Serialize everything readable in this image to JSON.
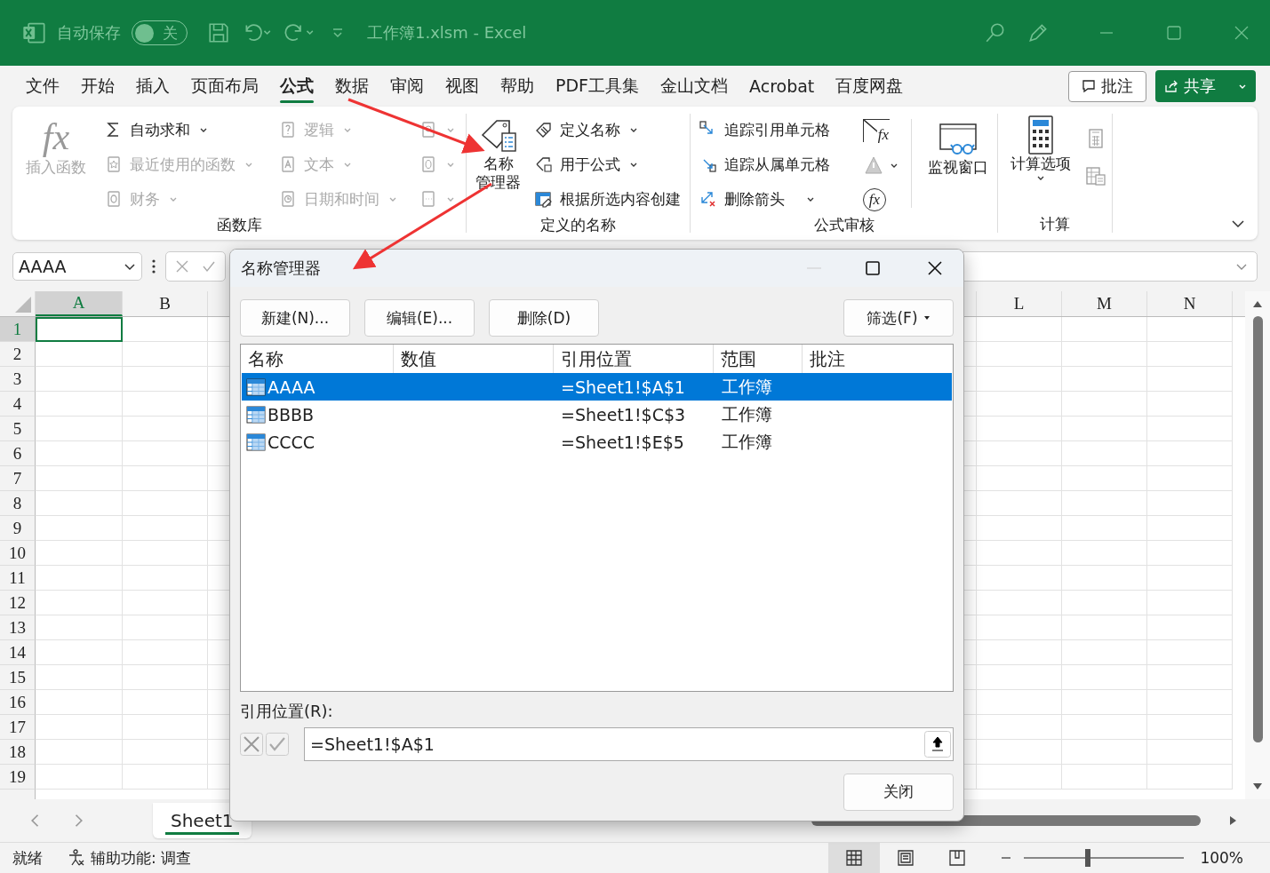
{
  "title_bar": {
    "autosave_label": "自动保存",
    "autosave": {
      "on": false,
      "label": "关"
    },
    "title": "工作簿1.xlsm  -  Excel"
  },
  "menu_tabs": [
    {
      "label": "文件",
      "selected": false
    },
    {
      "label": "开始",
      "selected": false
    },
    {
      "label": "插入",
      "selected": false
    },
    {
      "label": "页面布局",
      "selected": false
    },
    {
      "label": "公式",
      "selected": true
    },
    {
      "label": "数据",
      "selected": false
    },
    {
      "label": "审阅",
      "selected": false
    },
    {
      "label": "视图",
      "selected": false
    },
    {
      "label": "帮助",
      "selected": false
    },
    {
      "label": "PDF工具集",
      "selected": false
    },
    {
      "label": "金山文档",
      "selected": false
    },
    {
      "label": "Acrobat",
      "selected": false
    },
    {
      "label": "百度网盘",
      "selected": false
    }
  ],
  "comment_button": "批注",
  "share_button": "共享",
  "ribbon": {
    "function_library": {
      "label": "函数库",
      "insert_function": {
        "icon_text": "fx",
        "label": "插入函数",
        "disabled": true
      },
      "column_1": [
        {
          "label": "自动求和",
          "disabled": false
        },
        {
          "label": "最近使用的函数",
          "disabled": true
        },
        {
          "label": "财务",
          "disabled": true
        }
      ],
      "column_2": [
        {
          "label": "逻辑",
          "disabled": true
        },
        {
          "label": "文本",
          "disabled": true
        },
        {
          "label": "日期和时间",
          "disabled": true
        }
      ],
      "column_3": [
        {
          "disabled": true
        },
        {
          "disabled": true
        },
        {
          "disabled": true
        }
      ]
    },
    "defined_names": {
      "label": "定义的名称",
      "name_manager": [
        "名称",
        "管理器"
      ],
      "items": [
        {
          "label": "定义名称",
          "dropdown": true
        },
        {
          "label": "用于公式",
          "dropdown": true
        },
        {
          "label": "根据所选内容创建",
          "dropdown": false
        }
      ]
    },
    "formula_auditing": {
      "label": "公式审核",
      "icon_texts": [
        "fx",
        "fx"
      ],
      "items": [
        {
          "label": "追踪引用单元格",
          "dropdown": false
        },
        {
          "label": "追踪从属单元格",
          "dropdown": false
        },
        {
          "label": "删除箭头",
          "dropdown": true
        }
      ],
      "watch_window": "监视窗口"
    },
    "calculation": {
      "label": "计算",
      "options": "计算选项"
    }
  },
  "name_box": "AAAA",
  "columns": [
    {
      "label": "A",
      "selected": true
    },
    {
      "label": "B",
      "selected": false
    },
    {
      "label": "L",
      "selected": false
    },
    {
      "label": "M",
      "selected": false
    },
    {
      "label": "N",
      "selected": false
    }
  ],
  "rows": [
    {
      "label": "1",
      "selected": true
    },
    {
      "label": "2",
      "selected": false
    },
    {
      "label": "3",
      "selected": false
    },
    {
      "label": "4",
      "selected": false
    },
    {
      "label": "5",
      "selected": false
    },
    {
      "label": "6",
      "selected": false
    },
    {
      "label": "7",
      "selected": false
    },
    {
      "label": "8",
      "selected": false
    },
    {
      "label": "9",
      "selected": false
    },
    {
      "label": "10",
      "selected": false
    },
    {
      "label": "11",
      "selected": false
    },
    {
      "label": "12",
      "selected": false
    },
    {
      "label": "13",
      "selected": false
    },
    {
      "label": "14",
      "selected": false
    },
    {
      "label": "15",
      "selected": false
    },
    {
      "label": "16",
      "selected": false
    },
    {
      "label": "17",
      "selected": false
    },
    {
      "label": "18",
      "selected": false
    },
    {
      "label": "19",
      "selected": false
    }
  ],
  "sheet_tabs": [
    {
      "label": "Sheet1",
      "selected": true
    }
  ],
  "status_bar": {
    "status": "就绪",
    "accessibility": "辅助功能: 调查",
    "zoom": {
      "level": 0.4
    },
    "zoom_text": "100%"
  },
  "dialog": {
    "title": "名称管理器",
    "buttons": [
      "新建(N)...",
      "编辑(E)...",
      "删除(D)"
    ],
    "filter_button": "筛选(F)",
    "table": {
      "columns": [
        "名称",
        "数值",
        "引用位置",
        "范围",
        "批注"
      ],
      "rows": [
        {
          "name": "AAAA",
          "refers_to": "=Sheet1!$A$1",
          "scope": "工作簿",
          "selected": true
        },
        {
          "name": "BBBB",
          "refers_to": "=Sheet1!$C$3",
          "scope": "工作簿",
          "selected": false
        },
        {
          "name": "CCCC",
          "refers_to": "=Sheet1!$E$5",
          "scope": "工作簿",
          "selected": false
        }
      ]
    },
    "refers_label": "引用位置(R):",
    "refers_value": "=Sheet1!$A$1",
    "close_button": "关闭"
  }
}
